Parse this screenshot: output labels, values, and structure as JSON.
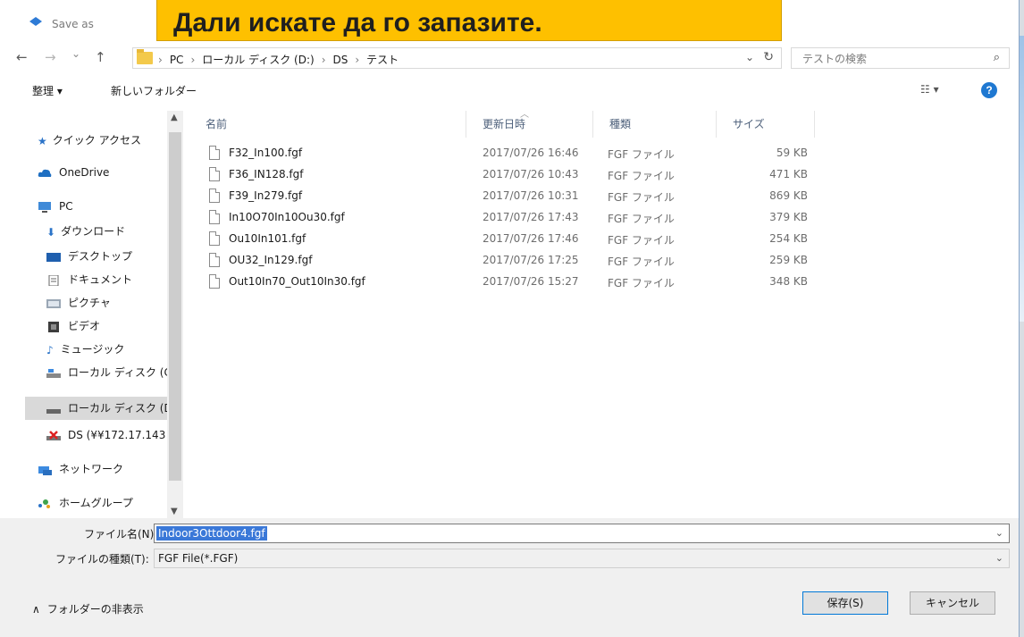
{
  "window": {
    "title": "Save as"
  },
  "banner": {
    "text": "Дали искате да го запазите."
  },
  "nav": {
    "back": "←",
    "forward": "→",
    "recent": "⌄",
    "up": "↑"
  },
  "breadcrumbs": [
    "PC",
    "ローカル ディスク (D:)",
    "DS",
    "テスト"
  ],
  "search": {
    "placeholder": "テストの検索"
  },
  "toolbar": {
    "organize": "整理 ▾",
    "new_folder": "新しいフォルダー"
  },
  "sidebar": {
    "items": [
      {
        "label": "クイック アクセス",
        "icon": "star-icon"
      },
      {
        "label": "OneDrive",
        "icon": "cloud-icon"
      },
      {
        "label": "PC",
        "icon": "computer-icon"
      },
      {
        "label": "ダウンロード",
        "icon": "download-icon"
      },
      {
        "label": "デスクトップ",
        "icon": "desktop-icon"
      },
      {
        "label": "ドキュメント",
        "icon": "document-icon"
      },
      {
        "label": "ピクチャ",
        "icon": "pictures-icon"
      },
      {
        "label": "ビデオ",
        "icon": "video-icon"
      },
      {
        "label": "ミュージック",
        "icon": "music-icon"
      },
      {
        "label": "ローカル ディスク (C",
        "icon": "drive-icon"
      },
      {
        "label": "ローカル ディスク (D",
        "icon": "drive-icon"
      },
      {
        "label": "DS (¥¥172.17.143",
        "icon": "network-drive-icon"
      },
      {
        "label": "ネットワーク",
        "icon": "network-icon"
      },
      {
        "label": "ホームグループ",
        "icon": "homegroup-icon"
      }
    ]
  },
  "columns": {
    "name": "名前",
    "date": "更新日時",
    "type": "種類",
    "size": "サイズ"
  },
  "files": [
    {
      "name": "F32_In100.fgf",
      "date": "2017/07/26 16:46",
      "type": "FGF ファイル",
      "size": "59 KB"
    },
    {
      "name": "F36_IN128.fgf",
      "date": "2017/07/26 10:43",
      "type": "FGF ファイル",
      "size": "471 KB"
    },
    {
      "name": "F39_In279.fgf",
      "date": "2017/07/26 10:31",
      "type": "FGF ファイル",
      "size": "869 KB"
    },
    {
      "name": "In10O70In10Ou30.fgf",
      "date": "2017/07/26 17:43",
      "type": "FGF ファイル",
      "size": "379 KB"
    },
    {
      "name": "Ou10In101.fgf",
      "date": "2017/07/26 17:46",
      "type": "FGF ファイル",
      "size": "254 KB"
    },
    {
      "name": "OU32_In129.fgf",
      "date": "2017/07/26 17:25",
      "type": "FGF ファイル",
      "size": "259 KB"
    },
    {
      "name": "Out10In70_Out10In30.fgf",
      "date": "2017/07/26 15:27",
      "type": "FGF ファイル",
      "size": "348 KB"
    }
  ],
  "filename": {
    "label": "ファイル名(N):",
    "value": "Indoor3Ottdoor4.fgf"
  },
  "filetype": {
    "label": "ファイルの種類(T):",
    "value": "FGF File(*.FGF)"
  },
  "hide_folders": "フォルダーの非表示",
  "buttons": {
    "save": "保存(S)",
    "cancel": "キャンセル"
  },
  "colors": {
    "banner": "#fec000",
    "selection": "#3a78d8",
    "help": "#1f78d1"
  }
}
